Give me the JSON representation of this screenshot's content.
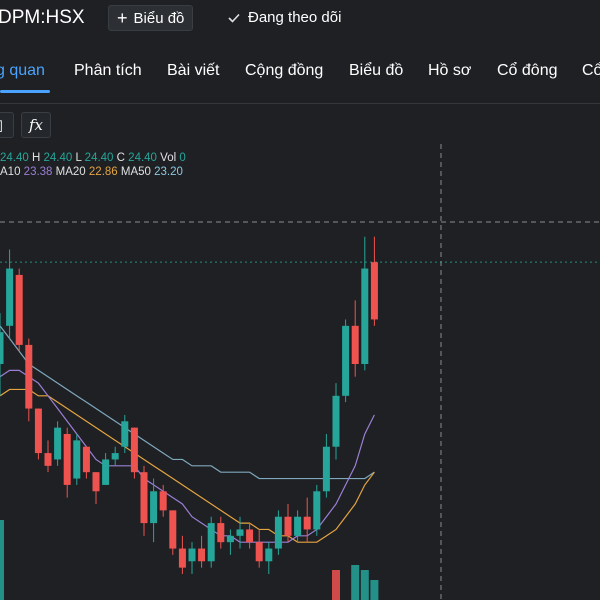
{
  "header": {
    "ticker": "DPM:HSX",
    "chart_button_label": "Biểu đồ",
    "follow_label": "Đang theo dõi"
  },
  "nav": {
    "tabs": [
      {
        "label": "g quan",
        "active": true
      },
      {
        "label": "Phân tích",
        "active": false
      },
      {
        "label": "Bài viết",
        "active": false
      },
      {
        "label": "Cộng đồng",
        "active": false
      },
      {
        "label": "Biểu đồ",
        "active": false
      },
      {
        "label": "Hồ sơ",
        "active": false
      },
      {
        "label": "Cổ đông",
        "active": false
      },
      {
        "label": "Cổ",
        "active": false
      }
    ]
  },
  "toolbar": {
    "fx_label": "fx"
  },
  "legend": {
    "o_value": "24.40",
    "h_label": "H",
    "h_value": "24.40",
    "l_label": "L",
    "l_value": "24.40",
    "c_label": "C",
    "c_value": "24.40",
    "vol_label": "Vol",
    "vol_value": "0",
    "ma10_label": "A10",
    "ma10_value": "23.38",
    "ma20_label": "MA20",
    "ma20_value": "22.86",
    "ma50_label": "MA50",
    "ma50_value": "23.20"
  },
  "colors": {
    "up": "#26a69a",
    "down": "#ef5350",
    "ma10": "#9c7fd4",
    "ma20": "#e5a442",
    "ma50": "#7fa8bd",
    "accent": "#4aa3ff"
  },
  "chart_data": {
    "type": "candlestick",
    "price_range": [
      19.5,
      25.0
    ],
    "candles": [
      {
        "o": 22.8,
        "h": 23.6,
        "l": 22.3,
        "c": 23.3
      },
      {
        "o": 23.4,
        "h": 24.6,
        "l": 23.2,
        "c": 24.3
      },
      {
        "o": 24.2,
        "h": 24.3,
        "l": 23.0,
        "c": 23.1
      },
      {
        "o": 23.1,
        "h": 23.2,
        "l": 21.9,
        "c": 22.1
      },
      {
        "o": 22.1,
        "h": 22.1,
        "l": 21.3,
        "c": 21.4
      },
      {
        "o": 21.4,
        "h": 21.6,
        "l": 21.1,
        "c": 21.2
      },
      {
        "o": 21.3,
        "h": 21.9,
        "l": 21.2,
        "c": 21.8
      },
      {
        "o": 21.7,
        "h": 21.8,
        "l": 20.7,
        "c": 20.9
      },
      {
        "o": 21.0,
        "h": 21.7,
        "l": 20.9,
        "c": 21.6
      },
      {
        "o": 21.5,
        "h": 21.5,
        "l": 21.0,
        "c": 21.1
      },
      {
        "o": 21.1,
        "h": 21.1,
        "l": 20.6,
        "c": 20.8
      },
      {
        "o": 20.9,
        "h": 21.4,
        "l": 20.9,
        "c": 21.3
      },
      {
        "o": 21.3,
        "h": 21.5,
        "l": 21.2,
        "c": 21.4
      },
      {
        "o": 21.5,
        "h": 22.0,
        "l": 21.4,
        "c": 21.9
      },
      {
        "o": 21.8,
        "h": 21.8,
        "l": 21.0,
        "c": 21.1
      },
      {
        "o": 21.1,
        "h": 21.2,
        "l": 20.1,
        "c": 20.3
      },
      {
        "o": 20.3,
        "h": 21.0,
        "l": 20.0,
        "c": 20.8
      },
      {
        "o": 20.8,
        "h": 20.9,
        "l": 20.4,
        "c": 20.5
      },
      {
        "o": 20.5,
        "h": 20.5,
        "l": 19.8,
        "c": 19.9
      },
      {
        "o": 19.9,
        "h": 20.1,
        "l": 19.5,
        "c": 19.6
      },
      {
        "o": 19.7,
        "h": 20.0,
        "l": 19.5,
        "c": 19.9
      },
      {
        "o": 19.9,
        "h": 20.1,
        "l": 19.6,
        "c": 19.7
      },
      {
        "o": 19.7,
        "h": 20.4,
        "l": 19.6,
        "c": 20.3
      },
      {
        "o": 20.3,
        "h": 20.4,
        "l": 19.9,
        "c": 20.0
      },
      {
        "o": 20.0,
        "h": 20.2,
        "l": 19.8,
        "c": 20.1
      },
      {
        "o": 20.1,
        "h": 20.4,
        "l": 19.9,
        "c": 20.2
      },
      {
        "o": 20.2,
        "h": 20.3,
        "l": 19.9,
        "c": 20.0
      },
      {
        "o": 20.0,
        "h": 20.2,
        "l": 19.6,
        "c": 19.7
      },
      {
        "o": 19.7,
        "h": 20.0,
        "l": 19.5,
        "c": 19.9
      },
      {
        "o": 19.9,
        "h": 20.5,
        "l": 19.8,
        "c": 20.4
      },
      {
        "o": 20.4,
        "h": 20.6,
        "l": 20.0,
        "c": 20.1
      },
      {
        "o": 20.1,
        "h": 20.5,
        "l": 20.0,
        "c": 20.4
      },
      {
        "o": 20.4,
        "h": 20.7,
        "l": 20.0,
        "c": 20.2
      },
      {
        "o": 20.2,
        "h": 20.9,
        "l": 20.1,
        "c": 20.8
      },
      {
        "o": 20.8,
        "h": 21.7,
        "l": 20.7,
        "c": 21.5
      },
      {
        "o": 21.5,
        "h": 22.5,
        "l": 21.3,
        "c": 22.3
      },
      {
        "o": 22.3,
        "h": 23.5,
        "l": 22.2,
        "c": 23.4
      },
      {
        "o": 23.4,
        "h": 23.8,
        "l": 22.6,
        "c": 22.8
      },
      {
        "o": 22.8,
        "h": 24.8,
        "l": 22.7,
        "c": 24.3
      },
      {
        "o": 24.4,
        "h": 24.8,
        "l": 23.4,
        "c": 23.5
      }
    ],
    "ma10": [
      22.6,
      22.7,
      22.7,
      22.6,
      22.5,
      22.3,
      22.1,
      21.9,
      21.7,
      21.5,
      21.3,
      21.2,
      21.2,
      21.2,
      21.2,
      21.0,
      20.9,
      20.8,
      20.7,
      20.6,
      20.4,
      20.3,
      20.2,
      20.1,
      20.1,
      20.0,
      20.0,
      20.0,
      20.0,
      20.0,
      20.0,
      20.1,
      20.1,
      20.2,
      20.4,
      20.6,
      20.9,
      21.2,
      21.7,
      22.0
    ],
    "ma20": [
      22.3,
      22.4,
      22.4,
      22.4,
      22.3,
      22.3,
      22.2,
      22.1,
      22.0,
      21.9,
      21.8,
      21.7,
      21.6,
      21.5,
      21.4,
      21.3,
      21.2,
      21.1,
      21.0,
      20.9,
      20.8,
      20.7,
      20.6,
      20.5,
      20.4,
      20.3,
      20.3,
      20.2,
      20.2,
      20.1,
      20.1,
      20.0,
      20.0,
      20.0,
      20.1,
      20.2,
      20.4,
      20.6,
      20.9,
      21.1
    ],
    "ma50": [
      23.4,
      23.2,
      23.0,
      22.8,
      22.7,
      22.6,
      22.5,
      22.4,
      22.3,
      22.2,
      22.1,
      22.0,
      21.9,
      21.8,
      21.7,
      21.6,
      21.5,
      21.4,
      21.3,
      21.3,
      21.2,
      21.2,
      21.2,
      21.1,
      21.1,
      21.1,
      21.1,
      21.0,
      21.0,
      21.0,
      21.0,
      21.0,
      21.0,
      21.0,
      21.0,
      21.0,
      21.0,
      21.0,
      21.0,
      21.1
    ],
    "volumes": [
      3.2,
      0,
      0,
      0,
      0,
      0,
      0,
      0,
      0,
      0,
      0,
      0,
      0,
      0,
      0,
      0,
      0,
      0,
      0,
      0,
      0,
      0,
      0,
      0,
      0,
      0,
      0,
      0,
      0,
      0,
      0,
      0,
      0,
      0,
      0,
      1.2,
      0,
      1.4,
      1.2,
      0.8
    ],
    "volume_colors": [
      "up",
      "up",
      "up",
      "up",
      "up",
      "up",
      "up",
      "up",
      "up",
      "up",
      "up",
      "up",
      "up",
      "up",
      "up",
      "up",
      "up",
      "up",
      "up",
      "up",
      "up",
      "up",
      "up",
      "up",
      "up",
      "up",
      "up",
      "up",
      "up",
      "up",
      "up",
      "up",
      "up",
      "up",
      "up",
      "down",
      "up",
      "up",
      "up",
      "up"
    ],
    "crosshair_price": 24.4
  }
}
